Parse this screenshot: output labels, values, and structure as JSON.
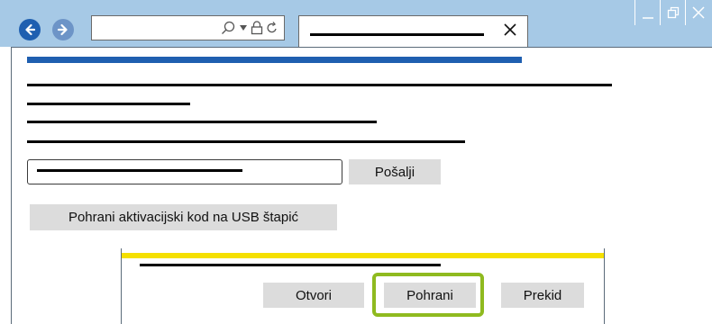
{
  "browser": {
    "controls": {
      "back_icon": "arrow-left-icon",
      "forward_icon": "arrow-right-icon",
      "search_icon": "search-icon",
      "dropdown_icon": "chevron-down-icon",
      "lock_icon": "lock-icon",
      "refresh_icon": "refresh-icon",
      "tab_close_icon": "close-icon",
      "minimize_icon": "minimize-icon",
      "restore_icon": "restore-icon",
      "window_close_icon": "close-icon"
    },
    "chrome_color": "#a6c9e6",
    "back_color": "#1f5fb0",
    "forward_color": "#6d94c7"
  },
  "page": {
    "accent_color": "#1f5fb0",
    "send_button_label": "Pošalji",
    "save_usb_button_label": "Pohrani aktivacijski kod na USB štapić"
  },
  "dialog": {
    "accent_color": "#f5e000",
    "open_button_label": "Otvori",
    "save_button_label": "Pohrani",
    "cancel_button_label": "Prekid",
    "highlight_color": "#8fba1f",
    "highlighted_button": "save"
  }
}
